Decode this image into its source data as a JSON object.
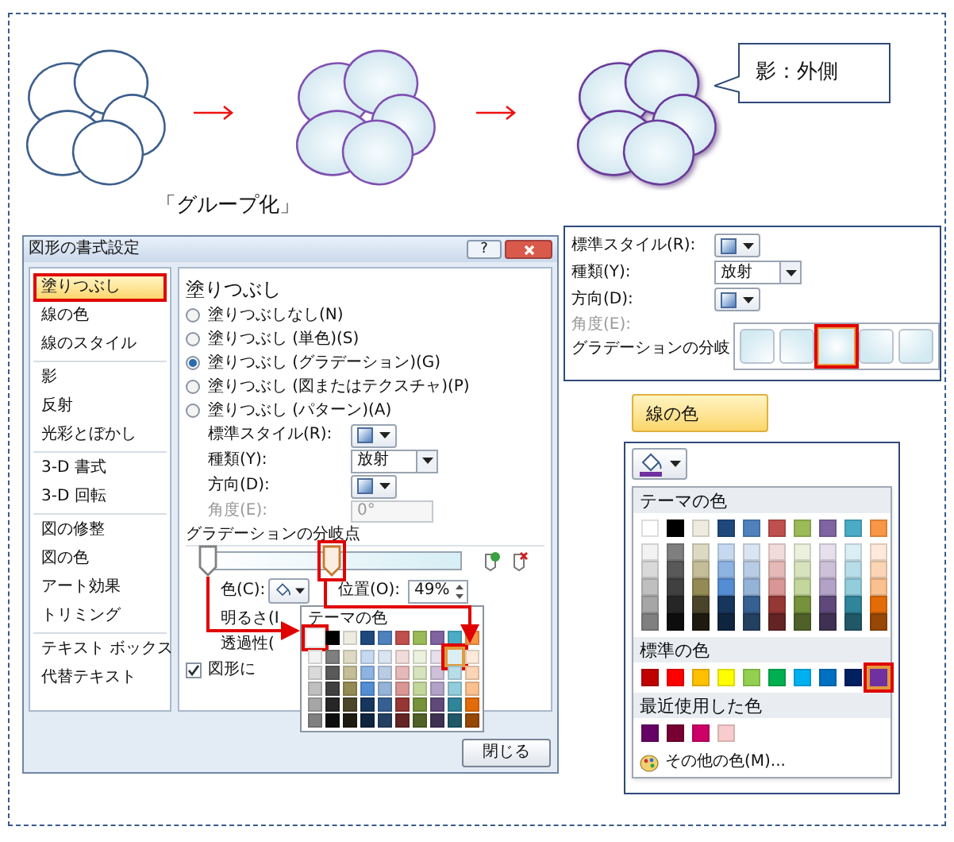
{
  "diagram": {
    "steps": [
      {
        "kind": "plain"
      },
      {
        "kind": "gradient"
      },
      {
        "kind": "shadow"
      }
    ],
    "group_caption": "「グループ化」",
    "callout": "影：外側"
  },
  "format_dialog": {
    "title": "図形の書式設定",
    "help_button": "?",
    "category_groups": [
      [
        {
          "label": "塗りつぶし",
          "selected": true,
          "highlighted": true
        },
        {
          "label": "線の色",
          "selected": false,
          "highlighted": false
        },
        {
          "label": "線のスタイル",
          "selected": false,
          "highlighted": false
        }
      ],
      [
        {
          "label": "影",
          "selected": false,
          "highlighted": false
        },
        {
          "label": "反射",
          "selected": false,
          "highlighted": false
        },
        {
          "label": "光彩とぼかし",
          "selected": false,
          "highlighted": false
        }
      ],
      [
        {
          "label": "3-D 書式",
          "selected": false,
          "highlighted": false
        },
        {
          "label": "3-D 回転",
          "selected": false,
          "highlighted": false
        }
      ],
      [
        {
          "label": "図の修整",
          "selected": false,
          "highlighted": false
        },
        {
          "label": "図の色",
          "selected": false,
          "highlighted": false
        },
        {
          "label": "アート効果",
          "selected": false,
          "highlighted": false
        },
        {
          "label": "トリミング",
          "selected": false,
          "highlighted": false
        }
      ],
      [
        {
          "label": "テキスト ボックス",
          "selected": false,
          "highlighted": false
        },
        {
          "label": "代替テキスト",
          "selected": false,
          "highlighted": false
        }
      ]
    ],
    "heading": "塗りつぶし",
    "fill_options": [
      {
        "label": "塗りつぶしなし(N)",
        "selected": false
      },
      {
        "label": "塗りつぶし (単色)(S)",
        "selected": false
      },
      {
        "label": "塗りつぶし (グラデーション)(G)",
        "selected": true
      },
      {
        "label": "塗りつぶし (図またはテクスチャ)(P)",
        "selected": false
      },
      {
        "label": "塗りつぶし (パターン)(A)",
        "selected": false
      }
    ],
    "preset_label": "標準スタイル(R):",
    "type_label": "種類(Y):",
    "type_value": "放射",
    "direction_label": "方向(D):",
    "angle": {
      "label": "角度(E):",
      "value": "0°",
      "disabled": true
    },
    "stops_label": "グラデーションの分岐点",
    "stops": [
      {
        "level": 0,
        "selected": false,
        "highlighted": false
      },
      {
        "level": 0.49,
        "selected": true,
        "highlighted": true
      }
    ],
    "color_label": "色(C):",
    "position_label": "位置(O):",
    "position_value": "49%",
    "brightness_label": "明るさ(I",
    "transparency_label": "透過性(",
    "rotate_checkbox": {
      "label": "図形に",
      "checked": true
    },
    "close_button": "閉じる",
    "color_popup": {
      "heading": "テーマの色",
      "theme_colors": [
        {
          "color": "#ffffff",
          "selected": false,
          "highlighted": true,
          "shades": [
            {
              "color": "#f2f2f2",
              "selected": false,
              "highlighted": false
            },
            {
              "color": "#d9d9d9",
              "selected": false,
              "highlighted": false
            },
            {
              "color": "#bfbfbf",
              "selected": false,
              "highlighted": false
            },
            {
              "color": "#a6a6a6",
              "selected": false,
              "highlighted": false
            },
            {
              "color": "#808080",
              "selected": false,
              "highlighted": false
            }
          ]
        },
        {
          "color": "#000000",
          "selected": false,
          "highlighted": false,
          "shades": [
            {
              "color": "#7f7f7f",
              "selected": false,
              "highlighted": false
            },
            {
              "color": "#595959",
              "selected": false,
              "highlighted": false
            },
            {
              "color": "#404040",
              "selected": false,
              "highlighted": false
            },
            {
              "color": "#262626",
              "selected": false,
              "highlighted": false
            },
            {
              "color": "#0d0d0d",
              "selected": false,
              "highlighted": false
            }
          ]
        },
        {
          "color": "#eeece1",
          "selected": false,
          "highlighted": false,
          "shades": [
            {
              "color": "#ddd9c3",
              "selected": false,
              "highlighted": false
            },
            {
              "color": "#c4bd97",
              "selected": false,
              "highlighted": false
            },
            {
              "color": "#948a54",
              "selected": false,
              "highlighted": false
            },
            {
              "color": "#4a452a",
              "selected": false,
              "highlighted": false
            },
            {
              "color": "#1d1b10",
              "selected": false,
              "highlighted": false
            }
          ]
        },
        {
          "color": "#1f497d",
          "selected": false,
          "highlighted": false,
          "shades": [
            {
              "color": "#c6d9f0",
              "selected": false,
              "highlighted": false
            },
            {
              "color": "#8db3e2",
              "selected": false,
              "highlighted": false
            },
            {
              "color": "#548dd4",
              "selected": false,
              "highlighted": false
            },
            {
              "color": "#17365d",
              "selected": false,
              "highlighted": false
            },
            {
              "color": "#0f243e",
              "selected": false,
              "highlighted": false
            }
          ]
        },
        {
          "color": "#4f81bd",
          "selected": false,
          "highlighted": false,
          "shades": [
            {
              "color": "#dbe5f1",
              "selected": false,
              "highlighted": false
            },
            {
              "color": "#b8cce4",
              "selected": false,
              "highlighted": false
            },
            {
              "color": "#95b3d7",
              "selected": false,
              "highlighted": false
            },
            {
              "color": "#366092",
              "selected": false,
              "highlighted": false
            },
            {
              "color": "#244061",
              "selected": false,
              "highlighted": false
            }
          ]
        },
        {
          "color": "#c0504d",
          "selected": false,
          "highlighted": false,
          "shades": [
            {
              "color": "#f2dcdb",
              "selected": false,
              "highlighted": false
            },
            {
              "color": "#e5b9b7",
              "selected": false,
              "highlighted": false
            },
            {
              "color": "#d99694",
              "selected": false,
              "highlighted": false
            },
            {
              "color": "#953734",
              "selected": false,
              "highlighted": false
            },
            {
              "color": "#632423",
              "selected": false,
              "highlighted": false
            }
          ]
        },
        {
          "color": "#9bbb59",
          "selected": false,
          "highlighted": false,
          "shades": [
            {
              "color": "#ebf1dd",
              "selected": false,
              "highlighted": false
            },
            {
              "color": "#d7e3bc",
              "selected": false,
              "highlighted": false
            },
            {
              "color": "#c3d69b",
              "selected": false,
              "highlighted": false
            },
            {
              "color": "#76923c",
              "selected": false,
              "highlighted": false
            },
            {
              "color": "#4f6128",
              "selected": false,
              "highlighted": false
            }
          ]
        },
        {
          "color": "#8064a2",
          "selected": false,
          "highlighted": false,
          "shades": [
            {
              "color": "#e5e0ec",
              "selected": false,
              "highlighted": false
            },
            {
              "color": "#ccc1d9",
              "selected": false,
              "highlighted": false
            },
            {
              "color": "#b2a2c7",
              "selected": false,
              "highlighted": false
            },
            {
              "color": "#5f497a",
              "selected": false,
              "highlighted": false
            },
            {
              "color": "#3f3151",
              "selected": false,
              "highlighted": false
            }
          ]
        },
        {
          "color": "#4bacc6",
          "selected": false,
          "highlighted": false,
          "shades": [
            {
              "color": "#dbeef3",
              "selected": true,
              "highlighted": true
            },
            {
              "color": "#b7dde8",
              "selected": false,
              "highlighted": false
            },
            {
              "color": "#92cddc",
              "selected": false,
              "highlighted": false
            },
            {
              "color": "#31859b",
              "selected": false,
              "highlighted": false
            },
            {
              "color": "#205867",
              "selected": false,
              "highlighted": false
            }
          ]
        },
        {
          "color": "#f79646",
          "selected": false,
          "highlighted": false,
          "shades": [
            {
              "color": "#fdeada",
              "selected": false,
              "highlighted": false
            },
            {
              "color": "#fbd5b5",
              "selected": false,
              "highlighted": false
            },
            {
              "color": "#fac08f",
              "selected": false,
              "highlighted": false
            },
            {
              "color": "#e36c09",
              "selected": false,
              "highlighted": false
            },
            {
              "color": "#974806",
              "selected": false,
              "highlighted": false
            }
          ]
        }
      ]
    }
  },
  "gradient_panel": {
    "preset_label": "標準スタイル(R):",
    "type_label": "種類(Y):",
    "type_value": "放射",
    "direction_label": "方向(D):",
    "angle_label": "角度(E):",
    "stops_label": "グラデーションの分岐",
    "direction_presets": [
      {
        "kind": "bottomright",
        "selected": false,
        "highlighted": false
      },
      {
        "kind": "bottomleft",
        "selected": false,
        "highlighted": false
      },
      {
        "kind": "center",
        "selected": true,
        "highlighted": true
      },
      {
        "kind": "topright",
        "selected": false,
        "highlighted": false
      },
      {
        "kind": "topleft",
        "selected": false,
        "highlighted": false
      }
    ]
  },
  "line_color_tab": {
    "label": "線の色",
    "selected": true
  },
  "line_color_panel": {
    "theme_heading": "テーマの色",
    "theme_colors": [
      {
        "color": "#ffffff",
        "selected": false,
        "shades": [
          {
            "color": "#f2f2f2",
            "selected": false
          },
          {
            "color": "#d9d9d9",
            "selected": false
          },
          {
            "color": "#bfbfbf",
            "selected": false
          },
          {
            "color": "#a6a6a6",
            "selected": false
          },
          {
            "color": "#808080",
            "selected": false
          }
        ]
      },
      {
        "color": "#000000",
        "selected": false,
        "shades": [
          {
            "color": "#7f7f7f",
            "selected": false
          },
          {
            "color": "#595959",
            "selected": false
          },
          {
            "color": "#404040",
            "selected": false
          },
          {
            "color": "#262626",
            "selected": false
          },
          {
            "color": "#0d0d0d",
            "selected": false
          }
        ]
      },
      {
        "color": "#eeece1",
        "selected": false,
        "shades": [
          {
            "color": "#ddd9c3",
            "selected": false
          },
          {
            "color": "#c4bd97",
            "selected": false
          },
          {
            "color": "#948a54",
            "selected": false
          },
          {
            "color": "#4a452a",
            "selected": false
          },
          {
            "color": "#1d1b10",
            "selected": false
          }
        ]
      },
      {
        "color": "#1f497d",
        "selected": false,
        "shades": [
          {
            "color": "#c6d9f0",
            "selected": false
          },
          {
            "color": "#8db3e2",
            "selected": false
          },
          {
            "color": "#548dd4",
            "selected": false
          },
          {
            "color": "#17365d",
            "selected": false
          },
          {
            "color": "#0f243e",
            "selected": false
          }
        ]
      },
      {
        "color": "#4f81bd",
        "selected": false,
        "shades": [
          {
            "color": "#dbe5f1",
            "selected": false
          },
          {
            "color": "#b8cce4",
            "selected": false
          },
          {
            "color": "#95b3d7",
            "selected": false
          },
          {
            "color": "#366092",
            "selected": false
          },
          {
            "color": "#244061",
            "selected": false
          }
        ]
      },
      {
        "color": "#c0504d",
        "selected": false,
        "shades": [
          {
            "color": "#f2dcdb",
            "selected": false
          },
          {
            "color": "#e5b9b7",
            "selected": false
          },
          {
            "color": "#d99694",
            "selected": false
          },
          {
            "color": "#953734",
            "selected": false
          },
          {
            "color": "#632423",
            "selected": false
          }
        ]
      },
      {
        "color": "#9bbb59",
        "selected": false,
        "shades": [
          {
            "color": "#ebf1dd",
            "selected": false
          },
          {
            "color": "#d7e3bc",
            "selected": false
          },
          {
            "color": "#c3d69b",
            "selected": false
          },
          {
            "color": "#76923c",
            "selected": false
          },
          {
            "color": "#4f6128",
            "selected": false
          }
        ]
      },
      {
        "color": "#8064a2",
        "selected": false,
        "shades": [
          {
            "color": "#e5e0ec",
            "selected": false
          },
          {
            "color": "#ccc1d9",
            "selected": false
          },
          {
            "color": "#b2a2c7",
            "selected": false
          },
          {
            "color": "#5f497a",
            "selected": false
          },
          {
            "color": "#3f3151",
            "selected": false
          }
        ]
      },
      {
        "color": "#4bacc6",
        "selected": false,
        "shades": [
          {
            "color": "#dbeef3",
            "selected": false
          },
          {
            "color": "#b7dde8",
            "selected": false
          },
          {
            "color": "#92cddc",
            "selected": false
          },
          {
            "color": "#31859b",
            "selected": false
          },
          {
            "color": "#205867",
            "selected": false
          }
        ]
      },
      {
        "color": "#f79646",
        "selected": false,
        "shades": [
          {
            "color": "#fdeada",
            "selected": false
          },
          {
            "color": "#fbd5b5",
            "selected": false
          },
          {
            "color": "#fac08f",
            "selected": false
          },
          {
            "color": "#e36c09",
            "selected": false
          },
          {
            "color": "#974806",
            "selected": false
          }
        ]
      }
    ],
    "standard_heading": "標準の色",
    "standard_colors": [
      {
        "color": "#c00000",
        "selected": false,
        "highlighted": false
      },
      {
        "color": "#ff0000",
        "selected": false,
        "highlighted": false
      },
      {
        "color": "#ffc000",
        "selected": false,
        "highlighted": false
      },
      {
        "color": "#ffff00",
        "selected": false,
        "highlighted": false
      },
      {
        "color": "#92d050",
        "selected": false,
        "highlighted": false
      },
      {
        "color": "#00b050",
        "selected": false,
        "highlighted": false
      },
      {
        "color": "#00b0f0",
        "selected": false,
        "highlighted": false
      },
      {
        "color": "#0070c0",
        "selected": false,
        "highlighted": false
      },
      {
        "color": "#002060",
        "selected": false,
        "highlighted": false
      },
      {
        "color": "#7030a0",
        "selected": true,
        "highlighted": true
      }
    ],
    "recent_heading": "最近使用した色",
    "recent_colors": [
      {
        "color": "#660066",
        "selected": false
      },
      {
        "color": "#770033",
        "selected": false
      },
      {
        "color": "#cc0066",
        "selected": false
      },
      {
        "color": "#f8cccc",
        "selected": false
      }
    ],
    "more_colors": "その他の色(M)..."
  }
}
